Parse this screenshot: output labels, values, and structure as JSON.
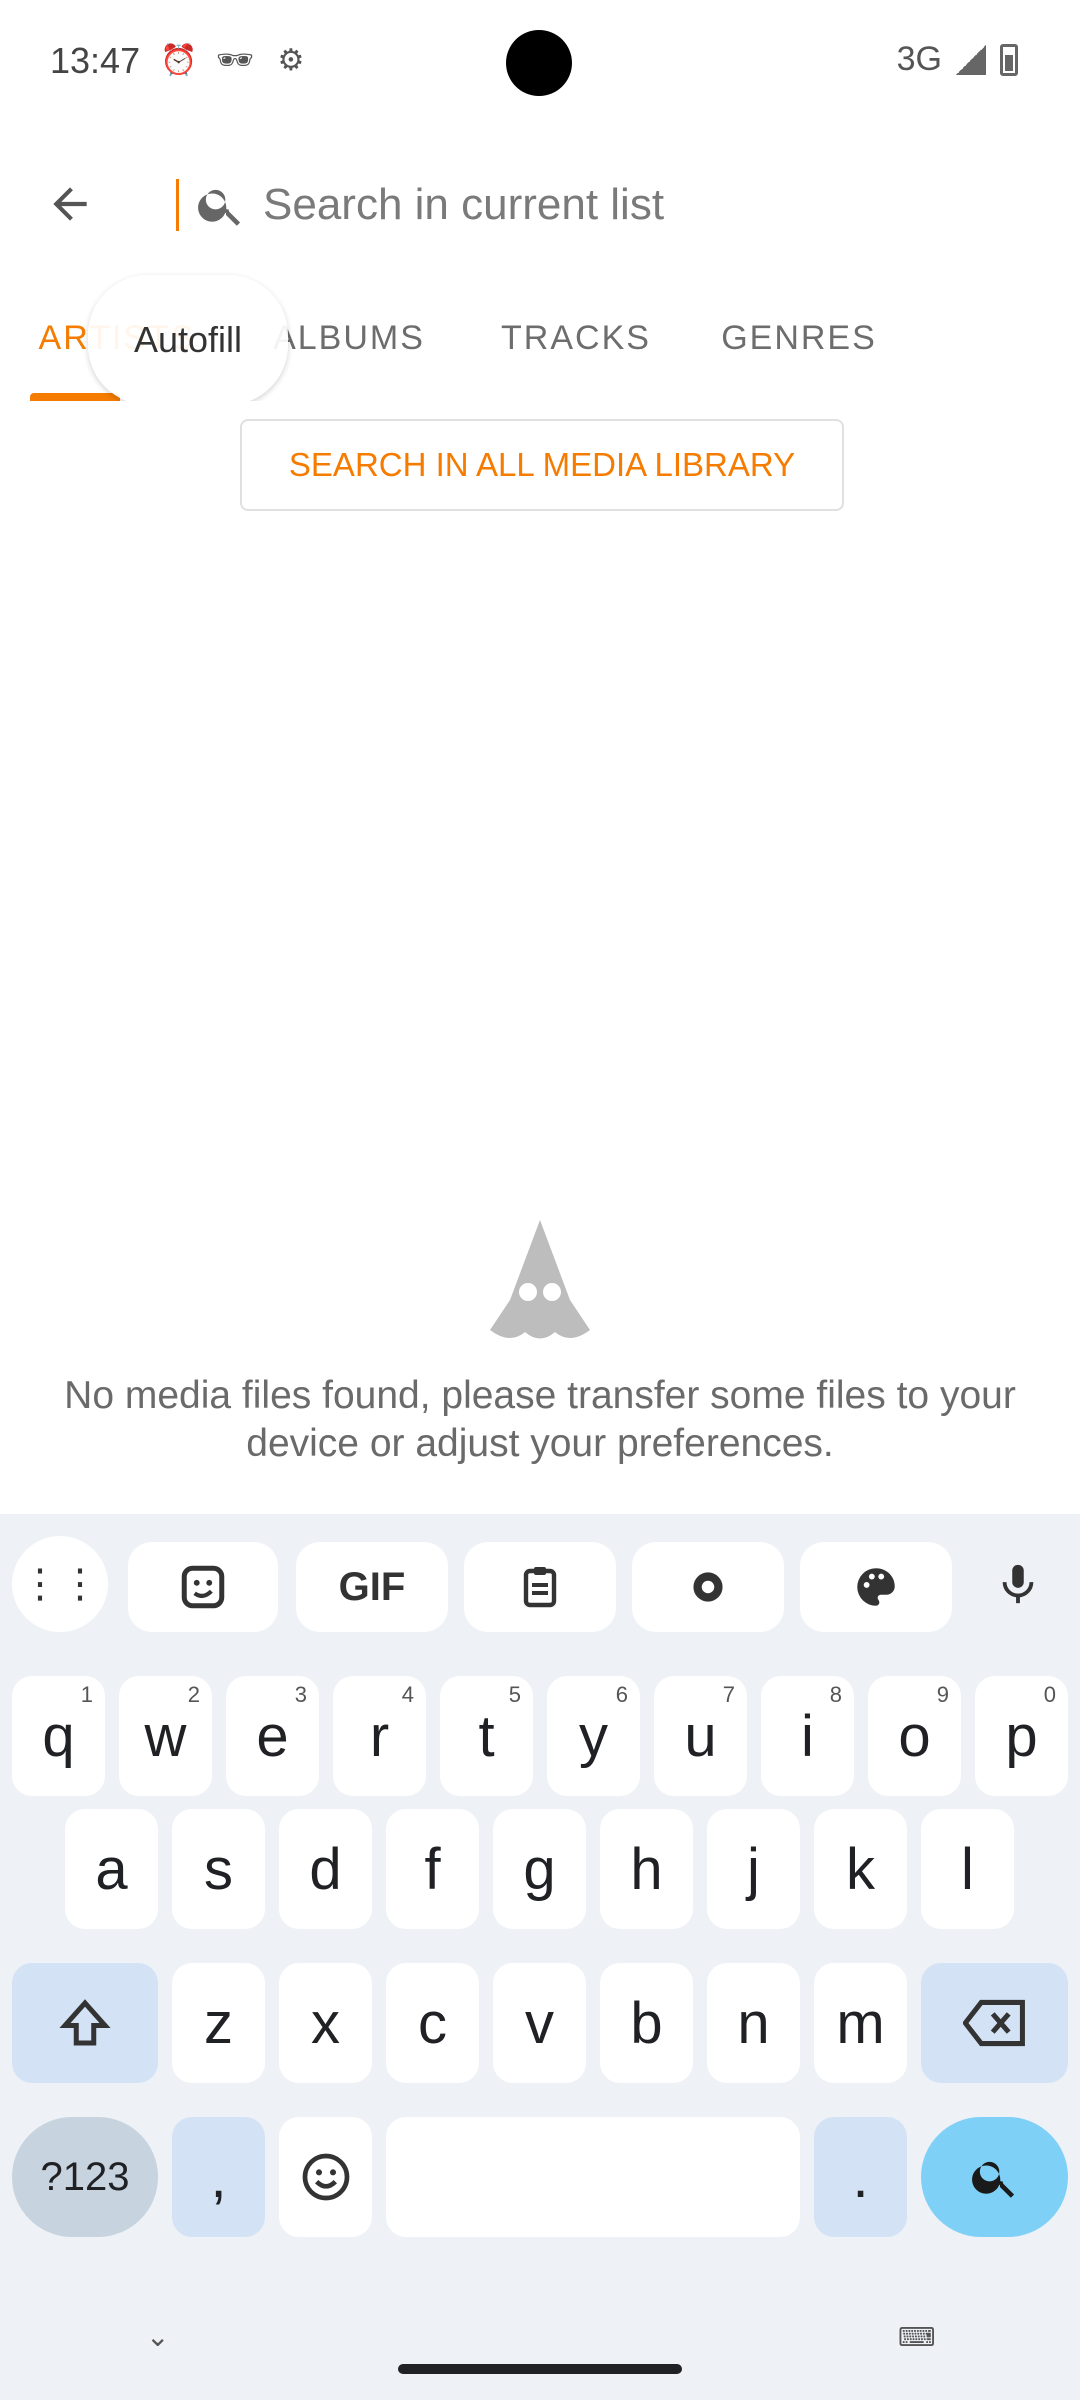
{
  "status_bar": {
    "time": "13:47",
    "network": "3G",
    "icons": [
      "alarm-icon",
      "incognito-icon",
      "settings-icon",
      "signal-icon",
      "battery-icon"
    ]
  },
  "toolbar": {
    "search_placeholder": "Search in current list"
  },
  "tabs": [
    {
      "label": "ARTISTS",
      "active": true
    },
    {
      "label": "ALBUMS",
      "active": false
    },
    {
      "label": "TRACKS",
      "active": false
    },
    {
      "label": "GENRES",
      "active": false
    }
  ],
  "autofill_label": "Autofill",
  "search_all_label": "SEARCH IN ALL MEDIA LIBRARY",
  "empty_state": {
    "message": "No media files found, please transfer some files to your device or adjust your preferences."
  },
  "keyboard": {
    "toolbar": [
      "apps-icon",
      "sticker-icon",
      "GIF",
      "clipboard-icon",
      "settings-icon",
      "palette-icon",
      "mic-icon"
    ],
    "row1": [
      "q",
      "w",
      "e",
      "r",
      "t",
      "y",
      "u",
      "i",
      "o",
      "p"
    ],
    "row1_hints": [
      "1",
      "2",
      "3",
      "4",
      "5",
      "6",
      "7",
      "8",
      "9",
      "0"
    ],
    "row2": [
      "a",
      "s",
      "d",
      "f",
      "g",
      "h",
      "j",
      "k",
      "l"
    ],
    "row3": [
      "z",
      "x",
      "c",
      "v",
      "b",
      "n",
      "m"
    ],
    "sym_label": "?123",
    "comma_label": ",",
    "period_label": "."
  },
  "colors": {
    "accent": "#f57c00",
    "keyboard_bg": "#eef1f5",
    "enter_key": "#7fd0f7"
  }
}
